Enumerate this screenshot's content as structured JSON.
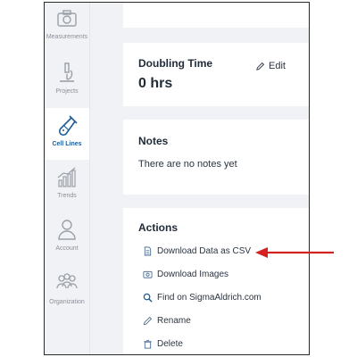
{
  "sidebar": {
    "items": [
      {
        "label": "Measurements",
        "icon": "camera-icon"
      },
      {
        "label": "Projects",
        "icon": "microscope-icon"
      },
      {
        "label": "Cell Lines",
        "icon": "test-tube-icon",
        "active": true
      },
      {
        "label": "Trends",
        "icon": "bar-chart-icon"
      },
      {
        "label": "Account",
        "icon": "user-icon"
      },
      {
        "label": "Organization",
        "icon": "group-icon"
      }
    ]
  },
  "doubling_time": {
    "title": "Doubling Time",
    "value": "0 hrs",
    "edit_label": "Edit"
  },
  "notes": {
    "title": "Notes",
    "text": "There are no notes yet"
  },
  "actions": {
    "title": "Actions",
    "items": [
      {
        "label": "Download Data as CSV",
        "icon": "document-icon"
      },
      {
        "label": "Download Images",
        "icon": "image-icon"
      },
      {
        "label": "Find on SigmaAldrich.com",
        "icon": "search-icon"
      },
      {
        "label": "Rename",
        "icon": "pencil-icon"
      },
      {
        "label": "Delete",
        "icon": "trash-icon"
      }
    ]
  },
  "colors": {
    "accent": "#1c5c99",
    "arrow": "#d42121",
    "sidebar_bg": "#f1f2f5",
    "card_bg": "#ffffff"
  }
}
